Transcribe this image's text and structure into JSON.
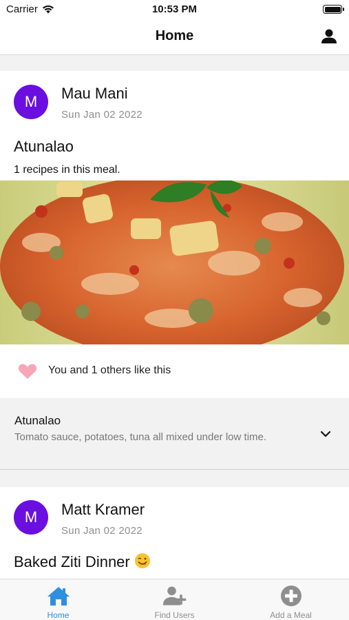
{
  "status_bar": {
    "carrier": "Carrier",
    "time": "10:53 PM"
  },
  "header": {
    "title": "Home",
    "user_icon": "person-icon"
  },
  "feed": [
    {
      "avatar_letter": "M",
      "author": "Mau Mani",
      "date": "Sun Jan 02 2022",
      "title": "Atunalao",
      "recipe_count": "1 recipes in this meal.",
      "likes_text": "You and 1 others like this",
      "recipe": {
        "name": "Atunalao",
        "description": "Tomato sauce, potatoes, tuna all mixed under low time."
      }
    },
    {
      "avatar_letter": "M",
      "author": "Matt Kramer",
      "date": "Sun Jan 02 2022",
      "title": "Baked Ziti Dinner"
    }
  ],
  "tabs": [
    {
      "label": "Home",
      "icon": "home-icon",
      "active": true
    },
    {
      "label": "Find Users",
      "icon": "add-user-icon",
      "active": false
    },
    {
      "label": "Add a Meal",
      "icon": "plus-circle-icon",
      "active": false
    }
  ],
  "colors": {
    "avatar": "#6a0fe0",
    "active_tab": "#2f8fe0",
    "inactive_tab": "#8e8e8e",
    "heart": "#f7a6b8"
  }
}
